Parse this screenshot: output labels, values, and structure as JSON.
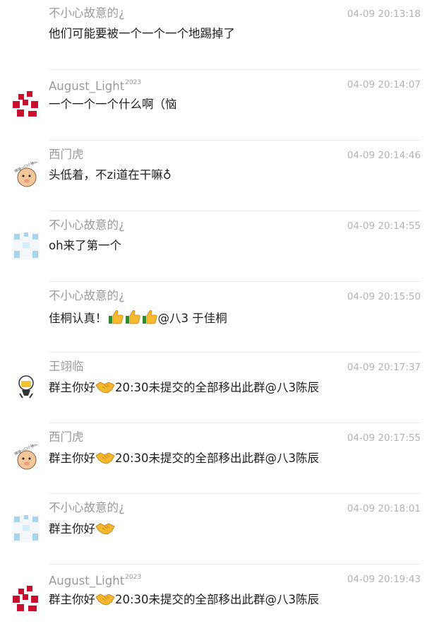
{
  "messages": [
    {
      "id": "m1",
      "sender": "不小心故意的¿",
      "badge": "",
      "time": "04-09 20:13:18",
      "avatar": "none",
      "parts": [
        {
          "t": "text",
          "v": "他们可能要被一个一个一个地踢掉了"
        }
      ]
    },
    {
      "id": "m2",
      "sender": "August_Light",
      "badge": "2023",
      "time": "04-09 20:14:07",
      "avatar": "red-blocks-icon",
      "parts": [
        {
          "t": "text",
          "v": "一个一个一个什么啊（恼"
        }
      ]
    },
    {
      "id": "m3",
      "sender": "西门虎",
      "badge": "",
      "time": "04-09 20:14:46",
      "avatar": "cartoon-pig-icon",
      "parts": [
        {
          "t": "text",
          "v": "头低着，不zi道在干嘛♁"
        }
      ]
    },
    {
      "id": "m4",
      "sender": "不小心故意的¿",
      "badge": "",
      "time": "04-09 20:14:55",
      "avatar": "blue-pixel-icon",
      "parts": [
        {
          "t": "text",
          "v": "oh来了第一个"
        }
      ]
    },
    {
      "id": "m5",
      "sender": "不小心故意的¿",
      "badge": "",
      "time": "04-09 20:15:50",
      "avatar": "none",
      "parts": [
        {
          "t": "text",
          "v": "佳桐认真！"
        },
        {
          "t": "emoji",
          "v": "thumbs-up-icon"
        },
        {
          "t": "emoji",
          "v": "thumbs-up-icon"
        },
        {
          "t": "emoji",
          "v": "thumbs-up-icon"
        },
        {
          "t": "text",
          "v": "@八3 于佳桐"
        }
      ]
    },
    {
      "id": "m6",
      "sender": "王翊临",
      "badge": "",
      "time": "04-09 20:17:37",
      "avatar": "lightbulb-character-icon",
      "parts": [
        {
          "t": "text",
          "v": "群主你好"
        },
        {
          "t": "emoji",
          "v": "handshake-icon"
        },
        {
          "t": "text",
          "v": "20:30未提交的全部移出此群@八3陈辰"
        }
      ]
    },
    {
      "id": "m7",
      "sender": "西门虎",
      "badge": "",
      "time": "04-09 20:17:55",
      "avatar": "cartoon-pig-icon",
      "parts": [
        {
          "t": "text",
          "v": "群主你好"
        },
        {
          "t": "emoji",
          "v": "handshake-icon"
        },
        {
          "t": "text",
          "v": "20:30未提交的全部移出此群@八3陈辰"
        }
      ]
    },
    {
      "id": "m8",
      "sender": "不小心故意的¿",
      "badge": "",
      "time": "04-09 20:18:01",
      "avatar": "blue-pixel-icon",
      "parts": [
        {
          "t": "text",
          "v": "群主你好"
        },
        {
          "t": "emoji",
          "v": "handshake-icon"
        }
      ]
    },
    {
      "id": "m9",
      "sender": "August_Light",
      "badge": "2023",
      "time": "04-09 20:19:43",
      "avatar": "red-blocks-icon",
      "parts": [
        {
          "t": "text",
          "v": "群主你好"
        },
        {
          "t": "emoji",
          "v": "handshake-icon"
        },
        {
          "t": "text",
          "v": "20:30未提交的全部移出此群@八3陈辰"
        }
      ]
    }
  ],
  "colors": {
    "sender_name": "#9a9a9a",
    "timestamp": "#b3b3b3",
    "message_text": "#1e1e1e",
    "divider": "#ececec",
    "avatar_red": "#c8102e",
    "avatar_blue": "#a8d4ee"
  }
}
